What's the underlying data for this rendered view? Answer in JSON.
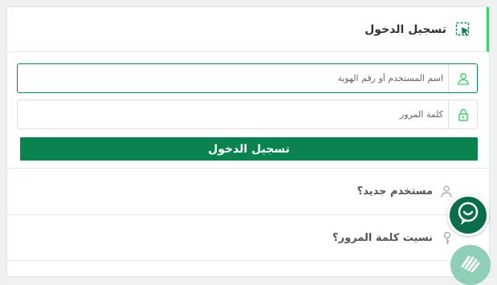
{
  "header": {
    "title": "تسجيل الدخول",
    "icon": "cursor-select-icon"
  },
  "form": {
    "username_placeholder": "اسم المستخدم أو رقم الهوية",
    "password_placeholder": "كلمة المرور",
    "submit_label": "تسجيل الدخول"
  },
  "links": {
    "new_user": "مستخدم جديد؟",
    "forgot_password": "نسيت كلمة المرور؟"
  },
  "colors": {
    "accent": "#0a8350",
    "header_bar": "#3ccf64"
  }
}
